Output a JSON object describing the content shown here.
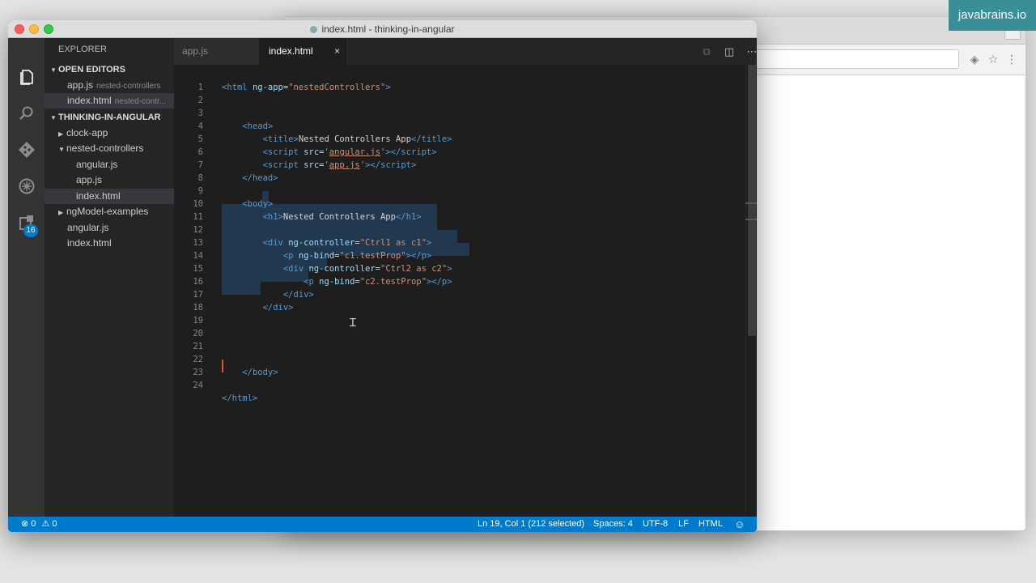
{
  "brand": "javabrains.io",
  "window": {
    "title": "index.html - thinking-in-angular"
  },
  "activity": {
    "explorer_icon": "files-icon",
    "search_icon": "search-icon",
    "git_icon": "git-icon",
    "debug_icon": "debug-icon",
    "extensions_icon": "extensions-icon",
    "extensions_badge": "16"
  },
  "sidebar": {
    "title": "EXPLORER",
    "open_editors_header": "OPEN EDITORS",
    "open_editors": [
      {
        "name": "app.js",
        "desc": "nested-controllers"
      },
      {
        "name": "index.html",
        "desc": "nested-contr..."
      }
    ],
    "project_header": "THINKING-IN-ANGULAR",
    "tree": [
      {
        "label": "clock-app"
      },
      {
        "label": "nested-controllers"
      },
      {
        "label": "angular.js"
      },
      {
        "label": "app.js"
      },
      {
        "label": "index.html"
      },
      {
        "label": "ngModel-examples"
      },
      {
        "label": "angular.js"
      },
      {
        "label": "index.html"
      }
    ]
  },
  "tabs": [
    {
      "label": "app.js"
    },
    {
      "label": "index.html",
      "close": "×"
    }
  ],
  "editor": {
    "line_numbers": [
      "1",
      "2",
      "3",
      "4",
      "5",
      "6",
      "7",
      "8",
      "9",
      "10",
      "11",
      "12",
      "13",
      "14",
      "15",
      "16",
      "17",
      "18",
      "19",
      "20",
      "21",
      "22",
      "23",
      "24"
    ]
  },
  "statusbar": {
    "errors": "0",
    "warnings": "0",
    "position": "Ln 19, Col 1 (212 selected)",
    "spaces": "Spaces: 4",
    "encoding": "UTF-8",
    "eol": "LF",
    "language": "HTML"
  },
  "colors": {
    "accent": "#007acc",
    "brand_bg": "#3a8e98"
  }
}
